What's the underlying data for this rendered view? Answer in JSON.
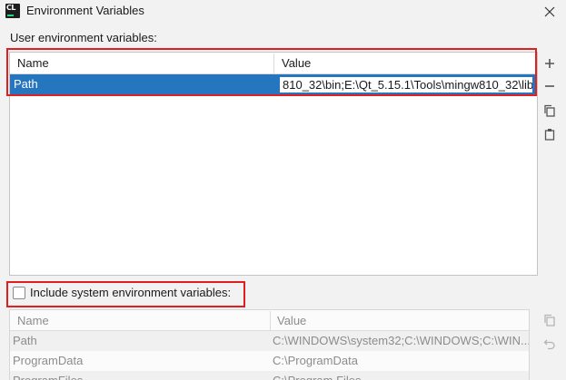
{
  "window": {
    "title": "Environment Variables",
    "app_icon_text": "CL"
  },
  "user_section": {
    "label": "User environment variables:",
    "columns": [
      "Name",
      "Value"
    ],
    "selected_row": {
      "name": "Path",
      "value_editing": "810_32\\bin;E:\\Qt_5.15.1\\Tools\\mingw810_32\\lib;"
    }
  },
  "toolbar": {
    "add_icon": "plus-icon",
    "remove_icon": "minus-icon",
    "copy_icon": "copy-icon",
    "paste_icon": "paste-icon"
  },
  "include_system": {
    "label": "Include system environment variables:",
    "checked": false
  },
  "system_section": {
    "columns": [
      "Name",
      "Value"
    ],
    "rows": [
      {
        "name": "Path",
        "value": "C:\\WINDOWS\\system32;C:\\WINDOWS;C:\\WIN..."
      },
      {
        "name": "ProgramData",
        "value": "C:\\ProgramData"
      },
      {
        "name": "ProgramFiles",
        "value": "C:\\Program Files"
      }
    ]
  },
  "colors": {
    "selection": "#2675bf",
    "highlight_box": "#e02020"
  }
}
